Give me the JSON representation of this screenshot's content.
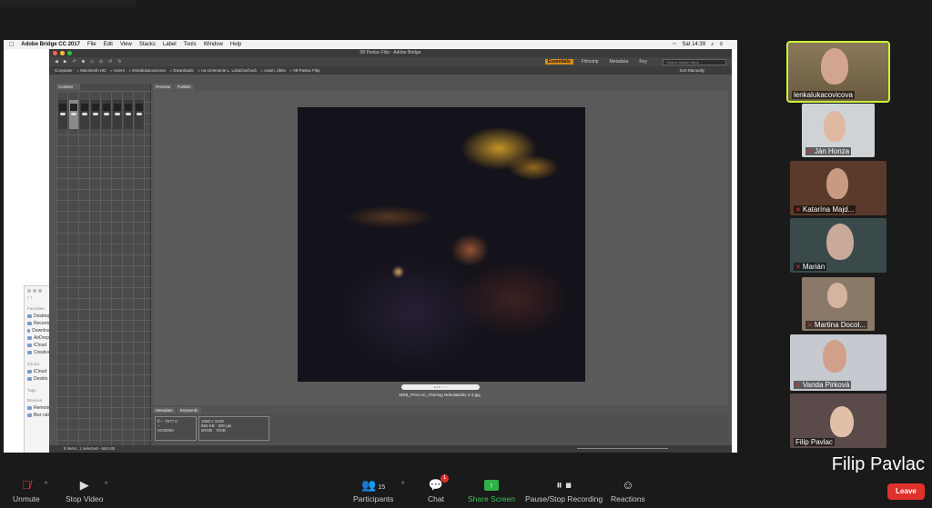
{
  "menubar": {
    "app_name": "Adobe Bridge CC 2017",
    "items": [
      "File",
      "Edit",
      "View",
      "Stacks",
      "Label",
      "Tools",
      "Window",
      "Help"
    ],
    "clock": "Sat 14:39"
  },
  "bridge": {
    "window_title": "08 Pavlac Filip - Adobe Bridge",
    "workspaces": [
      "Essentials",
      "Filmstrip",
      "Metadata",
      "Key"
    ],
    "active_workspace": "Essentials",
    "search_placeholder": "Search Adobe Stock",
    "breadcrumbs": [
      "Computer",
      "Macintosh HD",
      "Users",
      "lenkalukacovicova",
      "Downloads",
      "na ocnenanie L. Lukačovičová",
      "Autori, diela",
      "08 Pavlac Filip"
    ],
    "sort_label": "Sort Manually",
    "content_tab": "Content",
    "preview_tabs": [
      "Preview",
      "Publish"
    ],
    "metadata_tabs": [
      "Metadata",
      "Keywords"
    ],
    "preview_filename": "WEB_PAVLAC_Flaming NebulaEdit1-2-3.jpg",
    "meta_values": {
      "aperture": "f/--",
      "shutter": "7577.0",
      "dimensions": "1680 x 1649",
      "file_size": "650 KB",
      "resolution": "300 ppi",
      "color_space": "sRGB",
      "color_mode": "RGB",
      "flash": "--",
      "iso": "ISO0000"
    },
    "status": "8 items, 1 selected - 650 KB"
  },
  "finder": {
    "favorites_label": "Favorites",
    "favorites": [
      "Desktop",
      "Recents",
      "Downloads",
      "AirDrop",
      "iCloud",
      "Creative"
    ],
    "icloud_label": "iCloud",
    "icloud_items": [
      "iCloud",
      "Deskto"
    ],
    "tags_label": "Tags",
    "devices_label": "Devices",
    "devices": [
      "Remote",
      "Bez nás"
    ]
  },
  "participants": [
    {
      "name": "lenkalukacovicova",
      "muted": false,
      "active": true
    },
    {
      "name": "Ján Honza",
      "muted": true
    },
    {
      "name": "Katarína Majd...",
      "muted": true
    },
    {
      "name": "Marián",
      "muted": true
    },
    {
      "name": "Martina Docol...",
      "muted": true
    },
    {
      "name": "Vanda Pirková",
      "muted": true
    },
    {
      "name": "Filip Pavlac",
      "muted": false
    }
  ],
  "active_speaker": "Filip Pavlac",
  "toolbar": {
    "unmute": "Unmute",
    "stop_video": "Stop Video",
    "participants": "Participants",
    "participants_count": "15",
    "chat": "Chat",
    "chat_badge": "1",
    "share_screen": "Share Screen",
    "recording": "Pause/Stop Recording",
    "reactions": "Reactions",
    "leave": "Leave"
  }
}
